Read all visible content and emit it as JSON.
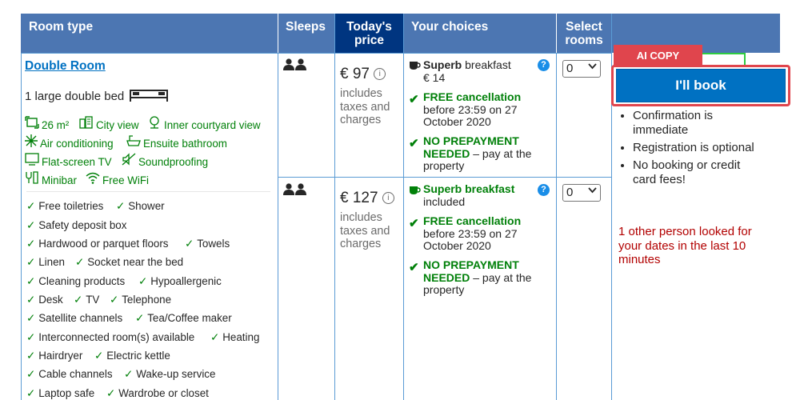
{
  "columns": {
    "room_type": "Room type",
    "sleeps": "Sleeps",
    "todays_price_line1": "Today's",
    "todays_price_line2": "price",
    "your_choices": "Your choices",
    "select_rooms_line1": "Select",
    "select_rooms_line2": "rooms"
  },
  "room": {
    "title": "Double Room",
    "bed": "1 large double bed",
    "facilities": [
      {
        "icon": "size-icon",
        "label": "26 m²"
      },
      {
        "icon": "city-view-icon",
        "label": "City view"
      },
      {
        "icon": "courtyard-view-icon",
        "label": "Inner courtyard view"
      },
      {
        "icon": "snowflake-icon",
        "label": "Air conditioning"
      },
      {
        "icon": "bathtub-icon",
        "label": "Ensuite bathroom"
      },
      {
        "icon": "tv-icon",
        "label": "Flat-screen TV"
      },
      {
        "icon": "soundproofing-icon",
        "label": "Soundproofing"
      },
      {
        "icon": "minibar-icon",
        "label": "Minibar"
      },
      {
        "icon": "wifi-icon",
        "label": "Free WiFi"
      }
    ],
    "amenities": [
      "Free toiletries",
      "Shower",
      "Safety deposit box",
      "Hardwood or parquet floors",
      "Towels",
      "Linen",
      "Socket near the bed",
      "Cleaning products",
      "Hypoallergenic",
      "Desk",
      "TV",
      "Telephone",
      "Satellite channels",
      "Tea/Coffee maker",
      "Interconnected room(s) available",
      "Heating",
      "Hairdryer",
      "Electric kettle",
      "Cable channels",
      "Wake-up service",
      "Laptop safe",
      "Wardrobe or closet"
    ]
  },
  "options": [
    {
      "price": "€ 97",
      "price_note": [
        "includes",
        "taxes and",
        "charges"
      ],
      "breakfast_bold": "Superb",
      "breakfast_rest": " breakfast",
      "breakfast_price": "€ 14",
      "cancel_title": "FREE cancellation",
      "cancel_text": [
        "before 23:59 on 27",
        "October 2020"
      ],
      "prepay_line1": "NO PREPAYMENT",
      "prepay_line2_bold": "NEEDED",
      "prepay_line2_rest": " – pay at the",
      "prepay_line3": "property",
      "rooms_selected": "0"
    },
    {
      "price": "€ 127",
      "price_note": [
        "includes",
        "taxes and",
        "charges"
      ],
      "breakfast_bold": "Superb breakfast",
      "breakfast_price": "included",
      "cancel_title": "FREE cancellation",
      "cancel_text": [
        "before 23:59 on 27",
        "October 2020"
      ],
      "prepay_line1": "NO PREPAYMENT",
      "prepay_line2_bold": "NEEDED",
      "prepay_line2_rest": " – pay at the",
      "prepay_line3": "property",
      "rooms_selected": "0"
    }
  ],
  "sidebar": {
    "ai_copy_label": "AI COPY",
    "book_button": "I'll book",
    "bullets": [
      [
        "Confirmation is",
        "immediate"
      ],
      [
        "Registration is optional"
      ],
      [
        "No booking or credit",
        "card fees!"
      ]
    ],
    "notice": [
      "1 other person looked for",
      "your dates in the last 10",
      "minutes"
    ]
  },
  "colors": {
    "header": "#4c76b2",
    "header_dark": "#003580",
    "green": "#008009",
    "link": "#0071c2",
    "button": "#0071c2",
    "ai_badge": "#e0454d",
    "notice": "#b20000"
  }
}
